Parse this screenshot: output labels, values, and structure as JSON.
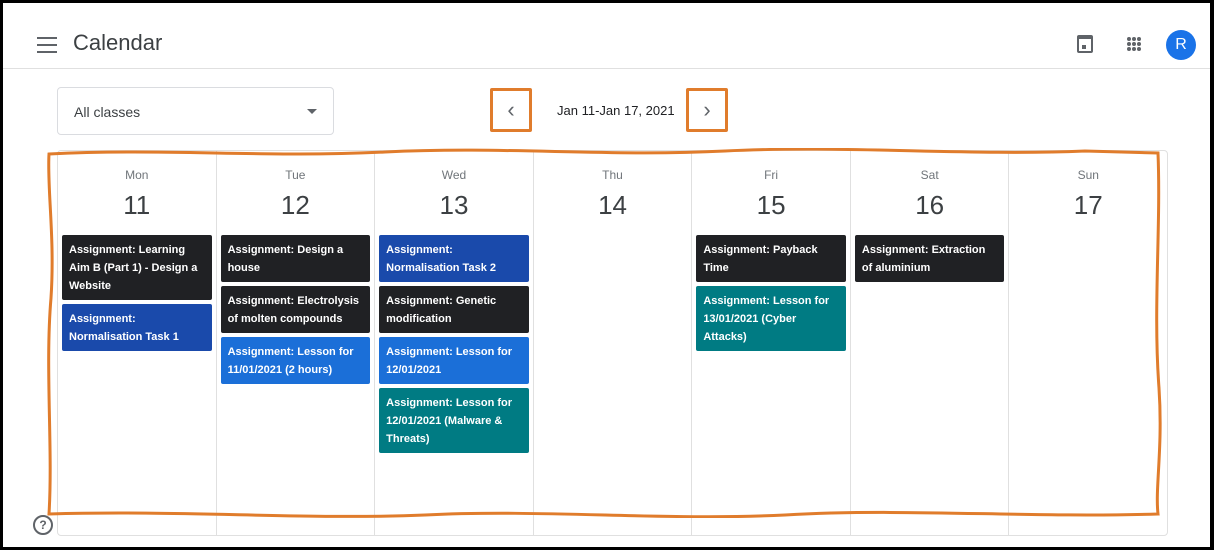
{
  "app": {
    "title": "Calendar",
    "avatar_initial": "R"
  },
  "filter": {
    "selected": "All classes"
  },
  "nav": {
    "prev": "‹",
    "next": "›",
    "date_range": "Jan 11-Jan 17, 2021"
  },
  "icons": {
    "menu": "hamburger-icon",
    "calendar": "calendar-icon",
    "apps": "apps-grid-icon",
    "help": "help-icon"
  },
  "colors": {
    "black": "#202124",
    "navy": "#1a4aab",
    "blue": "#1b6fd8",
    "teal": "#007b83",
    "highlight": "#e07c2c",
    "avatar": "#1a73e8"
  },
  "days": [
    {
      "dow": "Mon",
      "dom": "11",
      "events": [
        {
          "text": "Assignment: Learning Aim B (Part 1) - Design a Website",
          "color": "black"
        },
        {
          "text": "Assignment: Normalisation Task 1",
          "color": "navy"
        }
      ]
    },
    {
      "dow": "Tue",
      "dom": "12",
      "events": [
        {
          "text": "Assignment: Design a house",
          "color": "black"
        },
        {
          "text": "Assignment: Electrolysis of molten compounds",
          "color": "black"
        },
        {
          "text": "Assignment: Lesson for 11/01/2021 (2 hours)",
          "color": "blue"
        }
      ]
    },
    {
      "dow": "Wed",
      "dom": "13",
      "events": [
        {
          "text": "Assignment: Normalisation Task 2",
          "color": "navy"
        },
        {
          "text": "Assignment: Genetic modification",
          "color": "black"
        },
        {
          "text": "Assignment: Lesson for 12/01/2021",
          "color": "blue"
        },
        {
          "text": "Assignment: Lesson for 12/01/2021 (Malware & Threats)",
          "color": "teal"
        }
      ]
    },
    {
      "dow": "Thu",
      "dom": "14",
      "events": []
    },
    {
      "dow": "Fri",
      "dom": "15",
      "events": [
        {
          "text": "Assignment: Payback Time",
          "color": "black"
        },
        {
          "text": "Assignment: Lesson for 13/01/2021 (Cyber Attacks)",
          "color": "teal"
        }
      ]
    },
    {
      "dow": "Sat",
      "dom": "16",
      "events": [
        {
          "text": "Assignment: Extraction of aluminium",
          "color": "black"
        }
      ]
    },
    {
      "dow": "Sun",
      "dom": "17",
      "events": []
    }
  ]
}
